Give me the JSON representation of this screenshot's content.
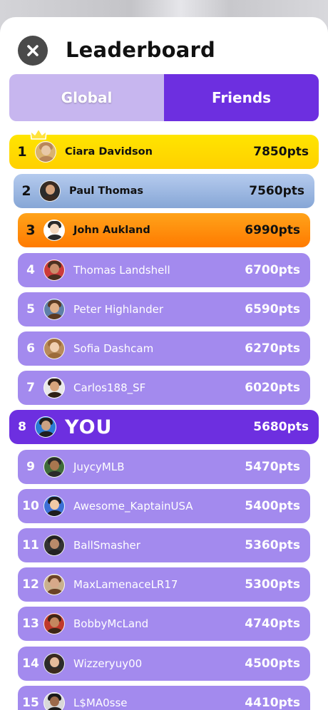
{
  "title": "Leaderboard",
  "tabs": {
    "global": "Global",
    "friends": "Friends",
    "active": "Friends"
  },
  "leaderboard": [
    {
      "rank": "1",
      "name": "Ciara Davidson",
      "points": "7850pts",
      "tier": "gold"
    },
    {
      "rank": "2",
      "name": "Paul Thomas",
      "points": "7560pts",
      "tier": "silver"
    },
    {
      "rank": "3",
      "name": "John Aukland",
      "points": "6990pts",
      "tier": "bronze"
    },
    {
      "rank": "4",
      "name": "Thomas Landshell",
      "points": "6700pts",
      "tier": "regular"
    },
    {
      "rank": "5",
      "name": "Peter Highlander",
      "points": "6590pts",
      "tier": "regular"
    },
    {
      "rank": "6",
      "name": "Sofia Dashcam",
      "points": "6270pts",
      "tier": "regular"
    },
    {
      "rank": "7",
      "name": "Carlos188_SF",
      "points": "6020pts",
      "tier": "regular"
    },
    {
      "rank": "8",
      "name": "YOU",
      "points": "5680pts",
      "tier": "you"
    },
    {
      "rank": "9",
      "name": "JuycyMLB",
      "points": "5470pts",
      "tier": "regular"
    },
    {
      "rank": "10",
      "name": "Awesome_KaptainUSA",
      "points": "5400pts",
      "tier": "regular"
    },
    {
      "rank": "11",
      "name": "BallSmasher",
      "points": "5360pts",
      "tier": "regular"
    },
    {
      "rank": "12",
      "name": "MaxLamenaceLR17",
      "points": "5300pts",
      "tier": "regular"
    },
    {
      "rank": "13",
      "name": "BobbyMcLand",
      "points": "4740pts",
      "tier": "regular"
    },
    {
      "rank": "14",
      "name": "Wizzeryuy00",
      "points": "4500pts",
      "tier": "regular"
    },
    {
      "rank": "15",
      "name": "L$MA0sse",
      "points": "4410pts",
      "tier": "regular"
    }
  ],
  "colors": {
    "gold": "#ffd900",
    "silver": "#9db8e2",
    "bronze": "#ff8a00",
    "row_purple": "#a38aee",
    "you_purple": "#6d2fe0",
    "tab_inactive": "#c7b6ef",
    "tab_active": "#6d2fe0"
  },
  "icons": {
    "close": "close-icon",
    "first_place": "crown-icon"
  }
}
